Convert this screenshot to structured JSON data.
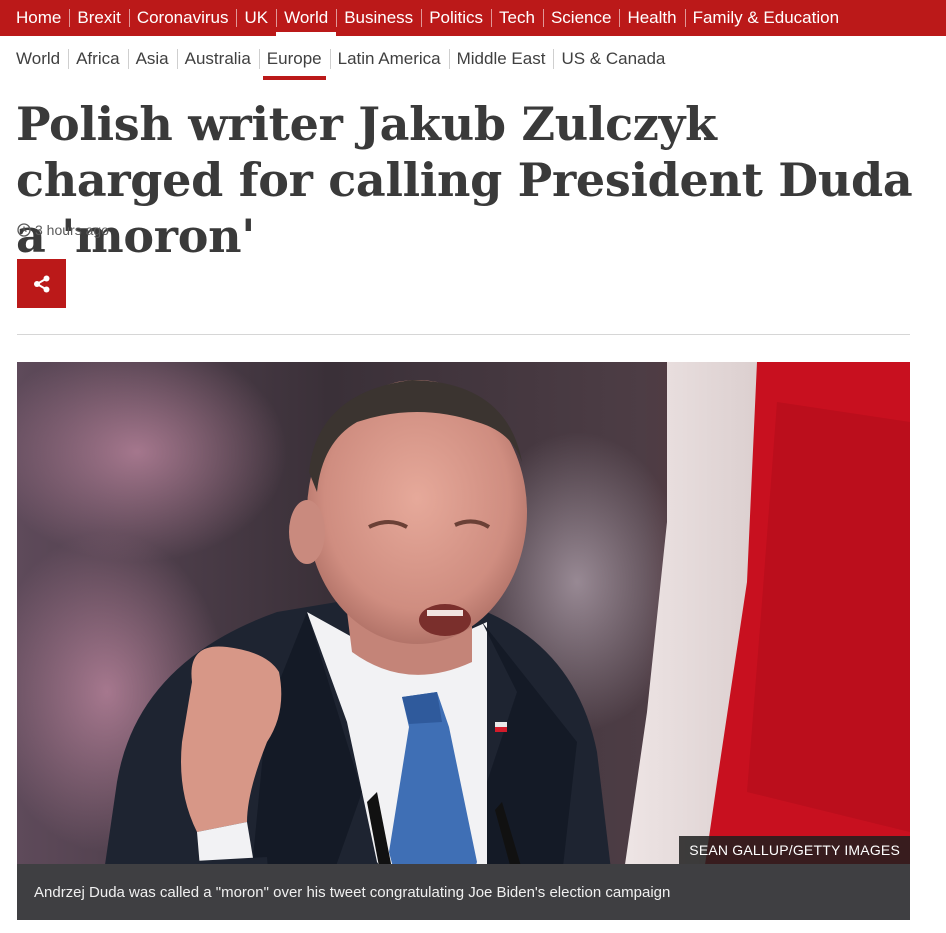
{
  "top_nav": {
    "items": [
      "Home",
      "Brexit",
      "Coronavirus",
      "UK",
      "World",
      "Business",
      "Politics",
      "Tech",
      "Science",
      "Health",
      "Family & Education"
    ],
    "active": "World",
    "background": "#bb1919"
  },
  "sub_nav": {
    "items": [
      "World",
      "Africa",
      "Asia",
      "Australia",
      "Europe",
      "Latin America",
      "Middle East",
      "US & Canada"
    ],
    "active": "Europe"
  },
  "article": {
    "headline": "Polish writer Jakub Zulczyk charged for calling President Duda a 'moron'",
    "timestamp": "3 hours ago",
    "share_icon": "share-icon",
    "image": {
      "credit": "SEAN GALLUP/GETTY IMAGES",
      "caption": "Andrzej Duda was called a \"moron\" over his tweet congratulating Joe Biden's election campaign"
    }
  },
  "colors": {
    "accent": "#bb1919",
    "headline": "#3a3a3a",
    "caption_bg": "#3f3f42"
  }
}
